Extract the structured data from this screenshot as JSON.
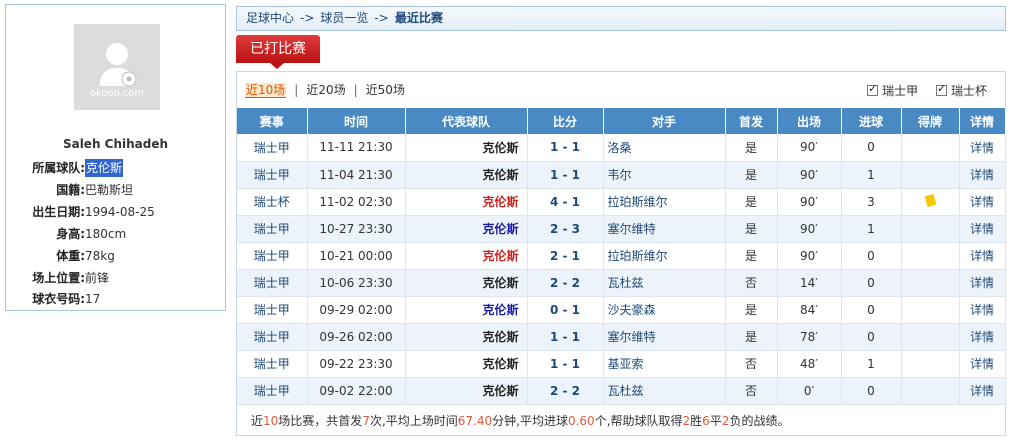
{
  "profile": {
    "photo_watermark": "okooo.com",
    "name": "Saleh Chihadeh",
    "rows": [
      {
        "label": "所属球队:",
        "value": "克伦斯"
      },
      {
        "label": "国籍:",
        "value": "巴勒斯坦"
      },
      {
        "label": "出生日期:",
        "value": "1994-08-25"
      },
      {
        "label": "身高:",
        "value": "180cm"
      },
      {
        "label": "体重:",
        "value": "78kg"
      },
      {
        "label": "场上位置:",
        "value": "前锋"
      },
      {
        "label": "球衣号码:",
        "value": "17"
      }
    ]
  },
  "breadcrumb": {
    "items": [
      "足球中心",
      "球员一览",
      "最近比赛"
    ],
    "separator": "->"
  },
  "title_tab": "已打比赛",
  "filters": {
    "options": [
      "近10场",
      "近20场",
      "近50场"
    ],
    "active_index": 0,
    "separator": "|"
  },
  "checkboxes": [
    {
      "label": "瑞士甲",
      "checked": true
    },
    {
      "label": "瑞士杯",
      "checked": true
    }
  ],
  "table": {
    "headers": [
      "赛事",
      "时间",
      "代表球队",
      "比分",
      "对手",
      "首发",
      "出场",
      "进球",
      "得牌",
      "详情"
    ],
    "rows": [
      {
        "comp": "瑞士甲",
        "time": "11-11 21:30",
        "team": "克伦斯",
        "team_color": "dark",
        "score": "1 - 1",
        "opp": "洛桑",
        "start": "是",
        "mins": "90′",
        "goals": "0",
        "card": "",
        "detail": "详情"
      },
      {
        "comp": "瑞士甲",
        "time": "11-04 21:30",
        "team": "克伦斯",
        "team_color": "dark",
        "score": "1 - 1",
        "opp": "韦尔",
        "start": "是",
        "mins": "90′",
        "goals": "1",
        "card": "",
        "detail": "详情"
      },
      {
        "comp": "瑞士杯",
        "time": "11-02 02:30",
        "team": "克伦斯",
        "team_color": "red",
        "score": "4 - 1",
        "opp": "拉珀斯维尔",
        "start": "是",
        "mins": "90′",
        "goals": "3",
        "card": "yellow",
        "detail": "详情"
      },
      {
        "comp": "瑞士甲",
        "time": "10-27 23:30",
        "team": "克伦斯",
        "team_color": "blue",
        "score": "2 - 3",
        "opp": "塞尔维特",
        "start": "是",
        "mins": "90′",
        "goals": "1",
        "card": "",
        "detail": "详情"
      },
      {
        "comp": "瑞士甲",
        "time": "10-21 00:00",
        "team": "克伦斯",
        "team_color": "red",
        "score": "2 - 1",
        "opp": "拉珀斯维尔",
        "start": "是",
        "mins": "90′",
        "goals": "0",
        "card": "",
        "detail": "详情"
      },
      {
        "comp": "瑞士甲",
        "time": "10-06 23:30",
        "team": "克伦斯",
        "team_color": "dark",
        "score": "2 - 2",
        "opp": "瓦杜兹",
        "start": "否",
        "mins": "14′",
        "goals": "0",
        "card": "",
        "detail": "详情"
      },
      {
        "comp": "瑞士甲",
        "time": "09-29 02:00",
        "team": "克伦斯",
        "team_color": "blue",
        "score": "0 - 1",
        "opp": "沙夫豪森",
        "start": "是",
        "mins": "84′",
        "goals": "0",
        "card": "",
        "detail": "详情"
      },
      {
        "comp": "瑞士甲",
        "time": "09-26 02:00",
        "team": "克伦斯",
        "team_color": "dark",
        "score": "1 - 1",
        "opp": "塞尔维特",
        "start": "是",
        "mins": "78′",
        "goals": "0",
        "card": "",
        "detail": "详情"
      },
      {
        "comp": "瑞士甲",
        "time": "09-22 23:30",
        "team": "克伦斯",
        "team_color": "dark",
        "score": "1 - 1",
        "opp": "基亚索",
        "start": "否",
        "mins": "48′",
        "goals": "1",
        "card": "",
        "detail": "详情"
      },
      {
        "comp": "瑞士甲",
        "time": "09-02 22:00",
        "team": "克伦斯",
        "team_color": "dark",
        "score": "2 - 2",
        "opp": "瓦杜兹",
        "start": "否",
        "mins": "0′",
        "goals": "0",
        "card": "",
        "detail": "详情"
      }
    ]
  },
  "summary": {
    "p1": "近",
    "n1": "10",
    "p2": "场比赛，共首发",
    "n2": "7",
    "p3": "次,平均上场时间",
    "n3": "67.40",
    "p4": "分钟,平均进球",
    "n4": "0.60",
    "p5": "个,帮助球队取得",
    "n5": "2",
    "p6": "胜",
    "n6": "6",
    "p7": "平",
    "n7": "2",
    "p8": "负的战绩。"
  },
  "colors": {
    "header_blue": "#4a8ac4",
    "title_red": "#c41c1c",
    "accent_orange": "#e05a00",
    "link_blue": "#1e4a7a",
    "row_alt": "#edf3fa",
    "yellow_card": "#f5c800"
  }
}
